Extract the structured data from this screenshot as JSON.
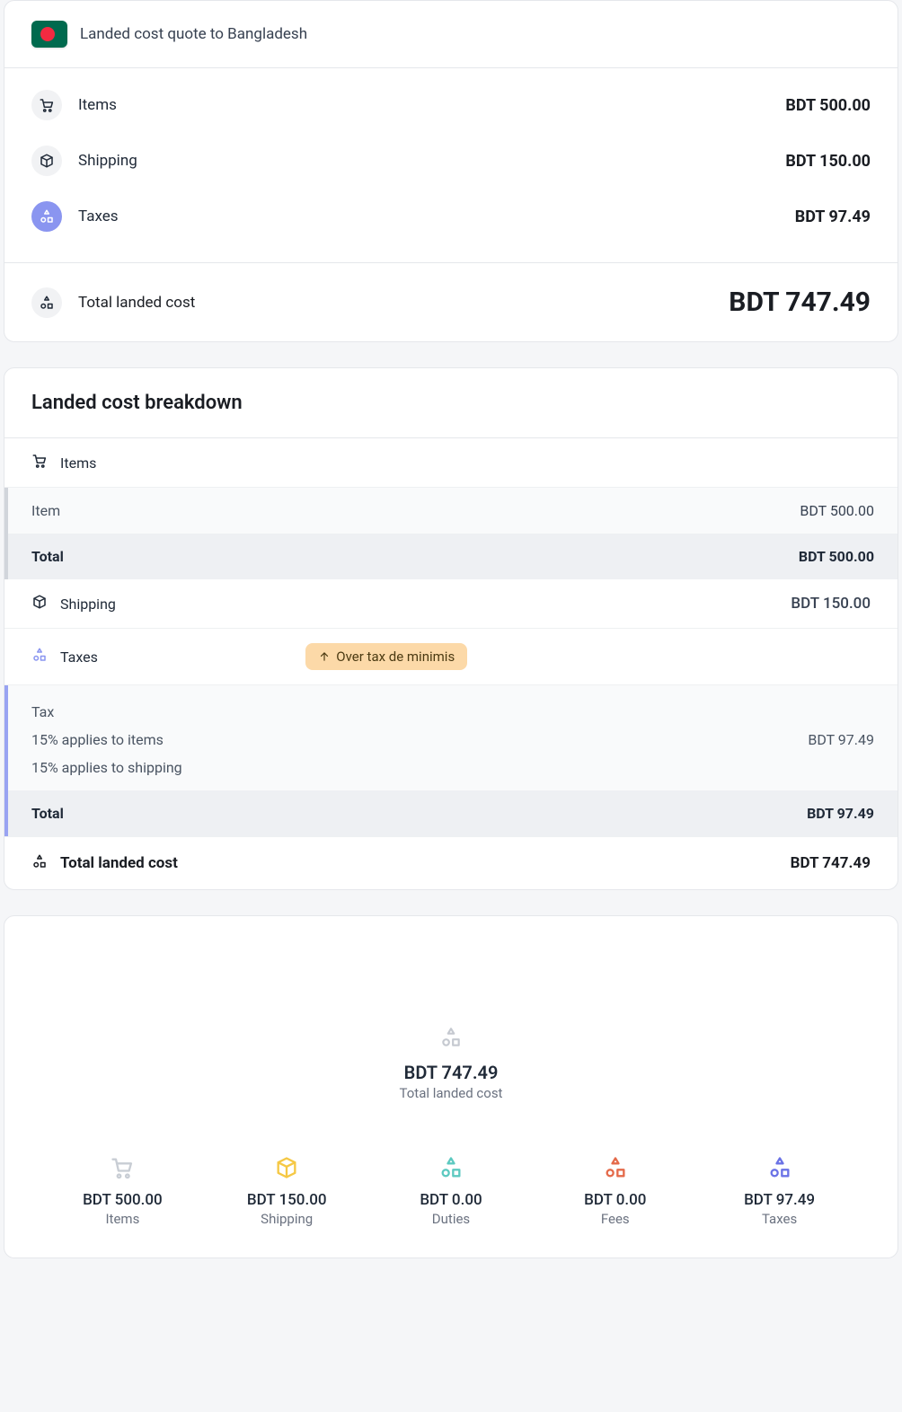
{
  "summary": {
    "title": "Landed cost quote to Bangladesh",
    "rows": [
      {
        "label": "Items",
        "value": "BDT 500.00"
      },
      {
        "label": "Shipping",
        "value": "BDT 150.00"
      },
      {
        "label": "Taxes",
        "value": "BDT 97.49"
      }
    ],
    "total_label": "Total landed cost",
    "total_value": "BDT 747.49"
  },
  "breakdown": {
    "title": "Landed cost breakdown",
    "items_label": "Items",
    "item_row_label": "Item",
    "item_row_value": "BDT 500.00",
    "items_total_label": "Total",
    "items_total_value": "BDT 500.00",
    "shipping_label": "Shipping",
    "shipping_value": "BDT 150.00",
    "taxes_label": "Taxes",
    "badge": "Over tax de minimis",
    "tax_header": "Tax",
    "tax_line1": "15% applies to items",
    "tax_line1_value": "BDT 97.49",
    "tax_line2": "15% applies to shipping",
    "tax_total_label": "Total",
    "tax_total_value": "BDT 97.49",
    "final_label": "Total landed cost",
    "final_value": "BDT 747.49"
  },
  "chart": {
    "center_amount": "BDT 747.49",
    "center_label": "Total landed cost",
    "legend": [
      {
        "amount": "BDT 500.00",
        "cap": "Items"
      },
      {
        "amount": "BDT 150.00",
        "cap": "Shipping"
      },
      {
        "amount": "BDT 0.00",
        "cap": "Duties"
      },
      {
        "amount": "BDT 0.00",
        "cap": "Fees"
      },
      {
        "amount": "BDT 97.49",
        "cap": "Taxes"
      }
    ]
  },
  "chart_data": {
    "type": "pie",
    "title": "Total landed cost",
    "total": 747.49,
    "currency": "BDT",
    "series": [
      {
        "name": "Items",
        "value": 500.0,
        "color": "#c8cdd4"
      },
      {
        "name": "Shipping",
        "value": 150.0,
        "color": "#f5c844"
      },
      {
        "name": "Duties",
        "value": 0.0,
        "color": "#5cc9c0"
      },
      {
        "name": "Fees",
        "value": 0.0,
        "color": "#e46a4a"
      },
      {
        "name": "Taxes",
        "value": 97.49,
        "color": "#6a72e6"
      }
    ]
  }
}
